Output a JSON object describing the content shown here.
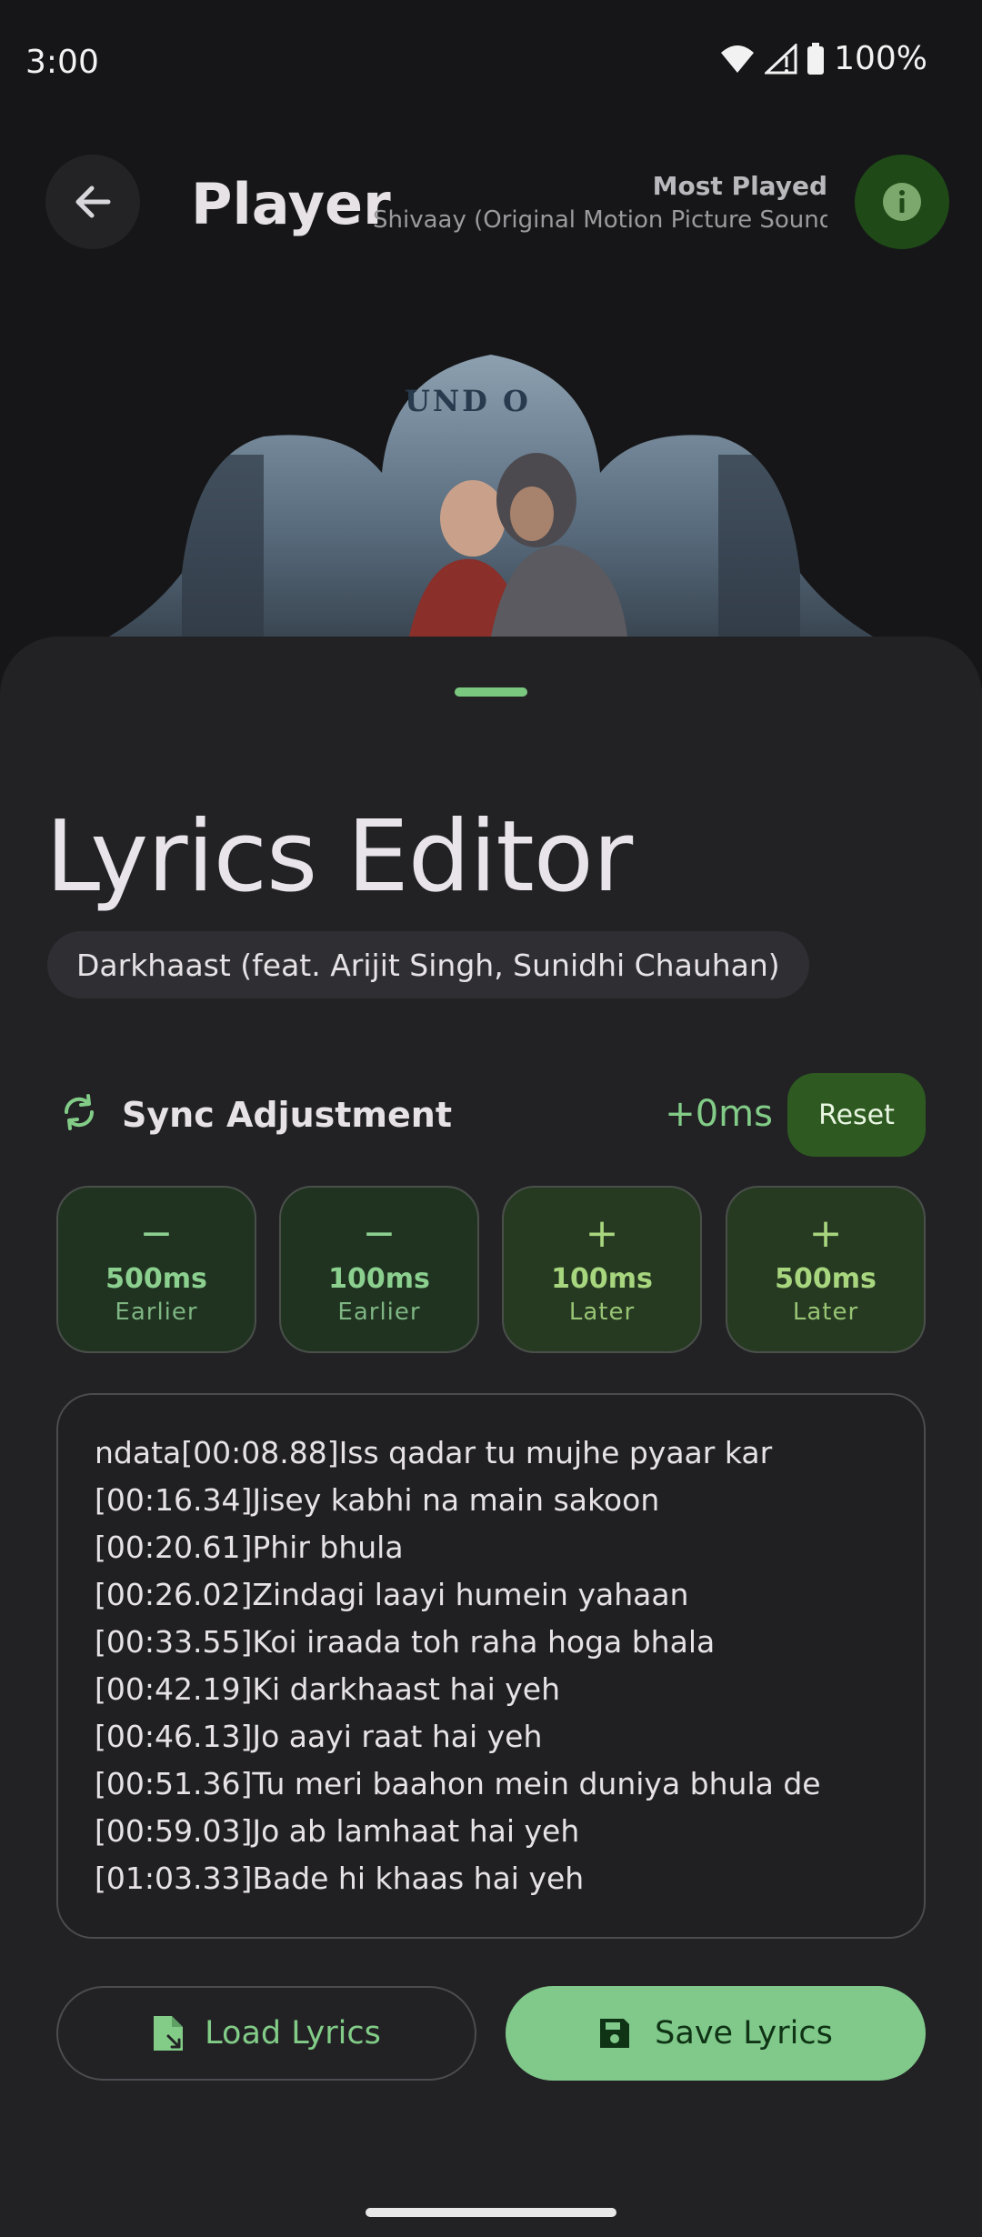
{
  "status_bar": {
    "time": "3:00",
    "battery": "100%"
  },
  "top_bar": {
    "title": "Player",
    "most_played_label": "Most Played",
    "now_playing_marquee": "Shivaay (Original Motion Picture Soundtrack)"
  },
  "album_art": {
    "partial_text": "UND O"
  },
  "editor": {
    "title": "Lyrics Editor",
    "song": "Darkhaast (feat. Arijit Singh, Sunidhi Chauhan)",
    "sync": {
      "label": "Sync Adjustment",
      "value": "+0ms",
      "reset_label": "Reset"
    },
    "adjust_buttons": [
      {
        "sign": "−",
        "value": "500ms",
        "direction": "Earlier"
      },
      {
        "sign": "−",
        "value": "100ms",
        "direction": "Earlier"
      },
      {
        "sign": "+",
        "value": "100ms",
        "direction": "Later"
      },
      {
        "sign": "+",
        "value": "500ms",
        "direction": "Later"
      }
    ],
    "lyrics_lines": [
      "ndata[00:08.88]Iss qadar tu mujhe pyaar kar",
      "[00:16.34]Jisey kabhi na main sakoon",
      "[00:20.61]Phir bhula",
      "[00:26.02]Zindagi laayi humein yahaan",
      "[00:33.55]Koi iraada toh raha hoga bhala",
      "[00:42.19]Ki darkhaast hai yeh",
      "[00:46.13]Jo aayi raat hai yeh",
      "[00:51.36]Tu meri baahon mein duniya bhula de",
      "[00:59.03]Jo ab lamhaat hai yeh",
      "[01:03.33]Bade hi khaas hai yeh"
    ],
    "load_label": "Load Lyrics",
    "save_label": "Save Lyrics"
  },
  "colors": {
    "accent": "#82cc87",
    "save_button": "#80c98a",
    "reset_button": "#2e5a22",
    "sheet_bg": "#222225"
  }
}
